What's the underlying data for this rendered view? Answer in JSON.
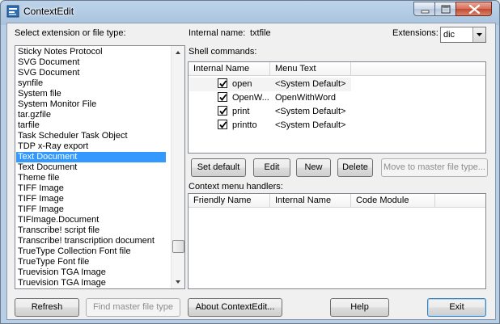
{
  "window": {
    "title": "ContextEdit"
  },
  "labels": {
    "select_ext": "Select extension or file type:",
    "internal_name_label": "Internal name:",
    "internal_name_value": "txtfile",
    "extensions": "Extensions:",
    "shell_commands": "Shell commands:",
    "context_handlers": "Context menu handlers:"
  },
  "extensions_combo": {
    "value": "dic"
  },
  "file_types": [
    "Sticky Notes Protocol",
    "SVG Document",
    "SVG Document",
    "synfile",
    "System file",
    "System Monitor File",
    "tar.gzfile",
    "tarfile",
    "Task Scheduler Task Object",
    "TDP x-Ray export",
    "Text Document",
    "Text Document",
    "Theme file",
    "TIFF Image",
    "TIFF Image",
    "TIFF Image",
    "TIFImage.Document",
    "Transcribe! script file",
    "Transcribe! transcription document",
    "TrueType Collection Font file",
    "TrueType Font file",
    "Truevision TGA Image",
    "Truevision TGA Image"
  ],
  "selected_file_type_index": 10,
  "shell_table": {
    "columns": [
      "Internal Name",
      "Menu Text"
    ],
    "rows": [
      {
        "checked": true,
        "internal": "open",
        "menu": "<System Default>"
      },
      {
        "checked": true,
        "internal": "OpenW...",
        "menu": "OpenWithWord"
      },
      {
        "checked": true,
        "internal": "print",
        "menu": "<System Default>"
      },
      {
        "checked": true,
        "internal": "printto",
        "menu": "<System Default>"
      }
    ]
  },
  "shell_buttons": {
    "set_default": "Set default",
    "edit": "Edit",
    "new": "New",
    "delete": "Delete",
    "move": "Move to master file type..."
  },
  "handlers_table": {
    "columns": [
      "Friendly Name",
      "Internal Name",
      "Code Module"
    ]
  },
  "bottom_buttons": {
    "refresh": "Refresh",
    "find_master": "Find master file type",
    "about": "About ContextEdit...",
    "help": "Help",
    "exit": "Exit"
  },
  "colors": {
    "selection": "#3399ff",
    "title_bar": "#a9c3de",
    "close_button": "#c24a30"
  }
}
